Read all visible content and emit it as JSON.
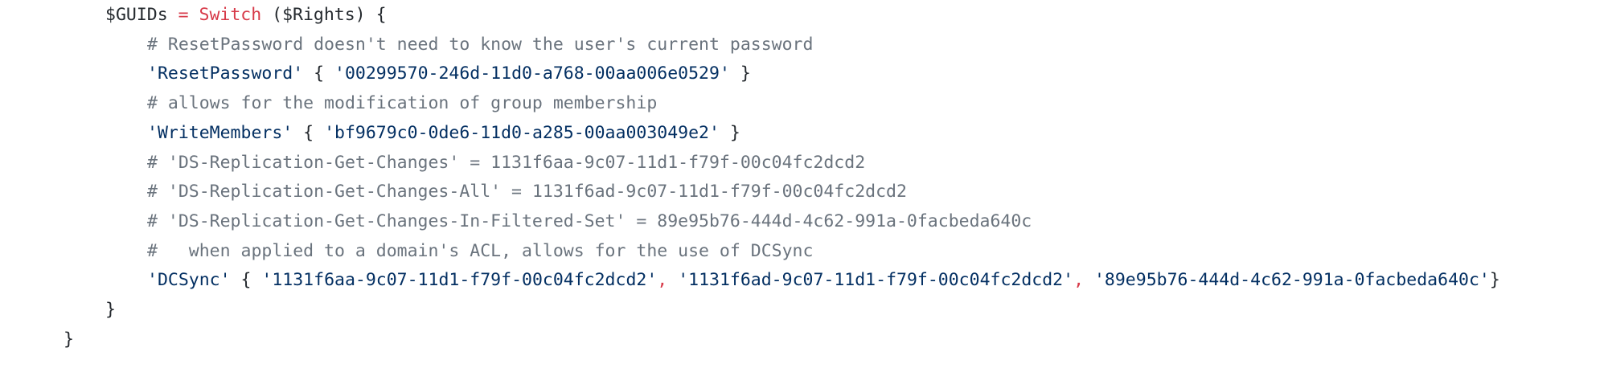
{
  "code": {
    "line1": {
      "var": "$GUIDs",
      "eq": " = ",
      "kw": "Switch",
      "rest": " ($Rights) {"
    },
    "line2": {
      "comment": "# ResetPassword doesn't need to know the user's current password"
    },
    "line3": {
      "key": "'ResetPassword'",
      "open": " { ",
      "val": "'00299570-246d-11d0-a768-00aa006e0529'",
      "close": " }"
    },
    "line4": {
      "comment": "# allows for the modification of group membership"
    },
    "line5": {
      "key": "'WriteMembers'",
      "open": " { ",
      "val": "'bf9679c0-0de6-11d0-a285-00aa003049e2'",
      "close": " }"
    },
    "line6": {
      "comment": "# 'DS-Replication-Get-Changes' = 1131f6aa-9c07-11d1-f79f-00c04fc2dcd2"
    },
    "line7": {
      "comment": "# 'DS-Replication-Get-Changes-All' = 1131f6ad-9c07-11d1-f79f-00c04fc2dcd2"
    },
    "line8": {
      "comment": "# 'DS-Replication-Get-Changes-In-Filtered-Set' = 89e95b76-444d-4c62-991a-0facbeda640c"
    },
    "line9": {
      "comment": "#   when applied to a domain's ACL, allows for the use of DCSync"
    },
    "line10": {
      "key": "'DCSync'",
      "open": " { ",
      "val1": "'1131f6aa-9c07-11d1-f79f-00c04fc2dcd2'",
      "sep1": ", ",
      "val2": "'1131f6ad-9c07-11d1-f79f-00c04fc2dcd2'",
      "sep2": ", ",
      "val3": "'89e95b76-444d-4c62-991a-0facbeda640c'",
      "close": "}"
    },
    "line11": {
      "brace": "}"
    },
    "line12": {
      "brace": "}"
    }
  },
  "colors": {
    "text": "#24292e",
    "keyword": "#d73a49",
    "comment": "#6a737d",
    "string": "#032f62",
    "background": "#ffffff"
  }
}
